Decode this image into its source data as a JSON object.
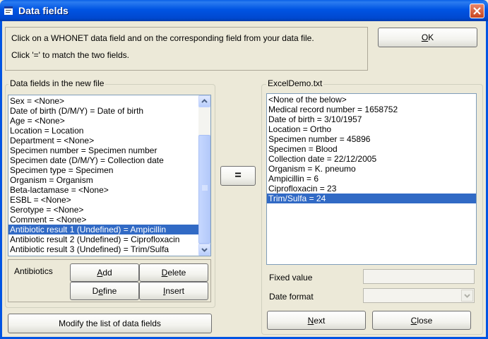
{
  "window": {
    "title": "Data fields"
  },
  "instructions": {
    "line1": "Click on a WHONET data field and on the corresponding field from your data file.",
    "line2": "Click '=' to match the two fields."
  },
  "ok_button": {
    "pre": "",
    "key": "O",
    "post": "K"
  },
  "left_group": {
    "legend": "Data fields in the new file"
  },
  "left_list": {
    "items": [
      "Sex = <None>",
      "Date of birth (D/M/Y) = Date of birth",
      "Age = <None>",
      "Location = Location",
      "Department = <None>",
      "Specimen number = Specimen number",
      "Specimen date (D/M/Y) = Collection date",
      "Specimen type = Specimen",
      "Organism = Organism",
      "Beta-lactamase = <None>",
      "ESBL = <None>",
      "Serotype = <None>",
      "Comment = <None>",
      "Antibiotic result 1 (Undefined) = Ampicillin",
      "Antibiotic result 2 (Undefined) = Ciprofloxacin",
      "Antibiotic result 3 (Undefined) = Trim/Sulfa"
    ],
    "selected_index": 13
  },
  "antibiotics": {
    "label": "Antibiotics",
    "add": {
      "pre": "",
      "key": "A",
      "post": "dd"
    },
    "delete": {
      "pre": "",
      "key": "D",
      "post": "elete"
    },
    "define": {
      "pre": "D",
      "key": "e",
      "post": "fine"
    },
    "insert": {
      "pre": "",
      "key": "I",
      "post": "nsert"
    }
  },
  "modify_button": "Modify the list of data fields",
  "equals_button": "=",
  "right_group": {
    "legend": "ExcelDemo.txt"
  },
  "right_list": {
    "items": [
      "<None of the below>",
      "Medical record number = 1658752",
      "Date of birth = 3/10/1957",
      "Location = Ortho",
      "Specimen number = 45896",
      "Specimen = Blood",
      "Collection date = 22/12/2005",
      "Organism = K. pneumo",
      "Ampicillin = 6",
      "Ciprofloxacin = 23",
      "Trim/Sulfa = 24"
    ],
    "selected_index": 10
  },
  "fixed_value": {
    "label": "Fixed value",
    "value": ""
  },
  "date_format": {
    "label": "Date format",
    "value": ""
  },
  "next_button": {
    "pre": "",
    "key": "N",
    "post": "ext"
  },
  "close_button": {
    "pre": "",
    "key": "C",
    "post": "lose"
  },
  "colors": {
    "title_bar": "#0054e3",
    "selection": "#316ac5",
    "face": "#ece9d8"
  }
}
